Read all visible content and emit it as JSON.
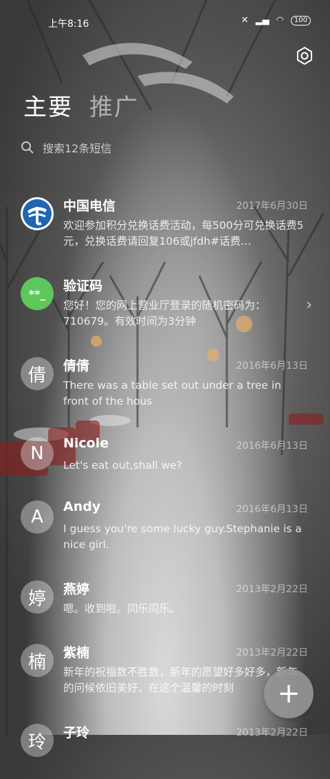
{
  "status": {
    "time": "上午8:16",
    "battery": "100"
  },
  "tabs": [
    {
      "label": "主要"
    },
    {
      "label": "推广"
    }
  ],
  "search": {
    "placeholder": "搜索12条短信"
  },
  "conversations": [
    {
      "name": "中国电信",
      "date": "2017年6月30日",
      "preview": "欢迎参加积分兑换话费活动，每500分可兑换话费5元，兑换话费请回复106或jfdh#话费…",
      "avatar": "",
      "avatar_icon": "china-telecom-logo"
    },
    {
      "name": "验证码",
      "date": "",
      "preview": "您好！您的网上营业厅登录的随机密码为：710679。有效时间为3分钟",
      "avatar": "**_"
    },
    {
      "name": "倩倩",
      "date": "2016年6月13日",
      "preview": "There was a table set out under a tree in front of the hous",
      "avatar": "倩"
    },
    {
      "name": "Nicole",
      "date": "2016年6月13日",
      "preview": "Let's eat out,shall we?",
      "avatar": "N"
    },
    {
      "name": "Andy",
      "date": "2016年6月13日",
      "preview": "I guess you're some lucky guy.Stephanie is a nice girl.",
      "avatar": "A"
    },
    {
      "name": "燕婷",
      "date": "2013年2月22日",
      "preview": "嗯。收到啦。同乐同乐。",
      "avatar": "婷"
    },
    {
      "name": "紫楠",
      "date": "2013年2月22日",
      "preview": "新年的祝福数不胜数，新年的愿望好多好多，新年的问候依旧美好，在这个温馨的时刻",
      "avatar": "楠"
    },
    {
      "name": "子玲",
      "date": "2013年2月22日",
      "preview": "",
      "avatar": "玲"
    }
  ],
  "fab": {
    "label": "+"
  }
}
